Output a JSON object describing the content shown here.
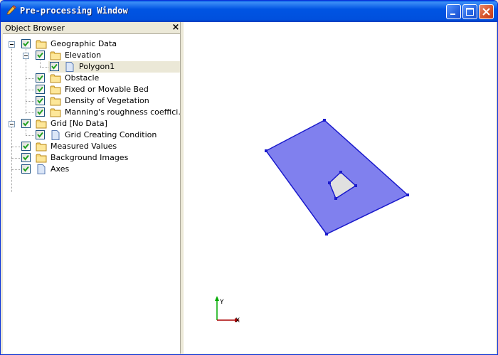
{
  "window": {
    "title": "Pre-processing Window",
    "accent": "#0054e3"
  },
  "browser": {
    "title": "Object Browser",
    "close_glyph": "×"
  },
  "tree": {
    "geographic_data": "Geographic Data",
    "elevation": "Elevation",
    "polygon1": "Polygon1",
    "obstacle": "Obstacle",
    "fixed_bed": "Fixed or Movable Bed",
    "vegetation": "Density of Vegetation",
    "manning": "Manning's roughness coeffici…",
    "grid": "Grid [No Data]",
    "grid_condition": "Grid Creating Condition",
    "measured": "Measured Values",
    "background": "Background Images",
    "axes": "Axes"
  },
  "canvas": {
    "polygon_fill": "#8080ee",
    "polygon_stroke": "#1a1acc",
    "hole_fill": "#e0e0e0",
    "axis_y_label": "Y",
    "axis_x_label": "X",
    "axis_y_color": "#00aa00",
    "axis_x_color": "#aa0000"
  },
  "icons": {
    "folder": "folder-icon",
    "document": "document-icon",
    "checkbox": "checkbox-checked-icon",
    "title": "pencil-icon"
  }
}
